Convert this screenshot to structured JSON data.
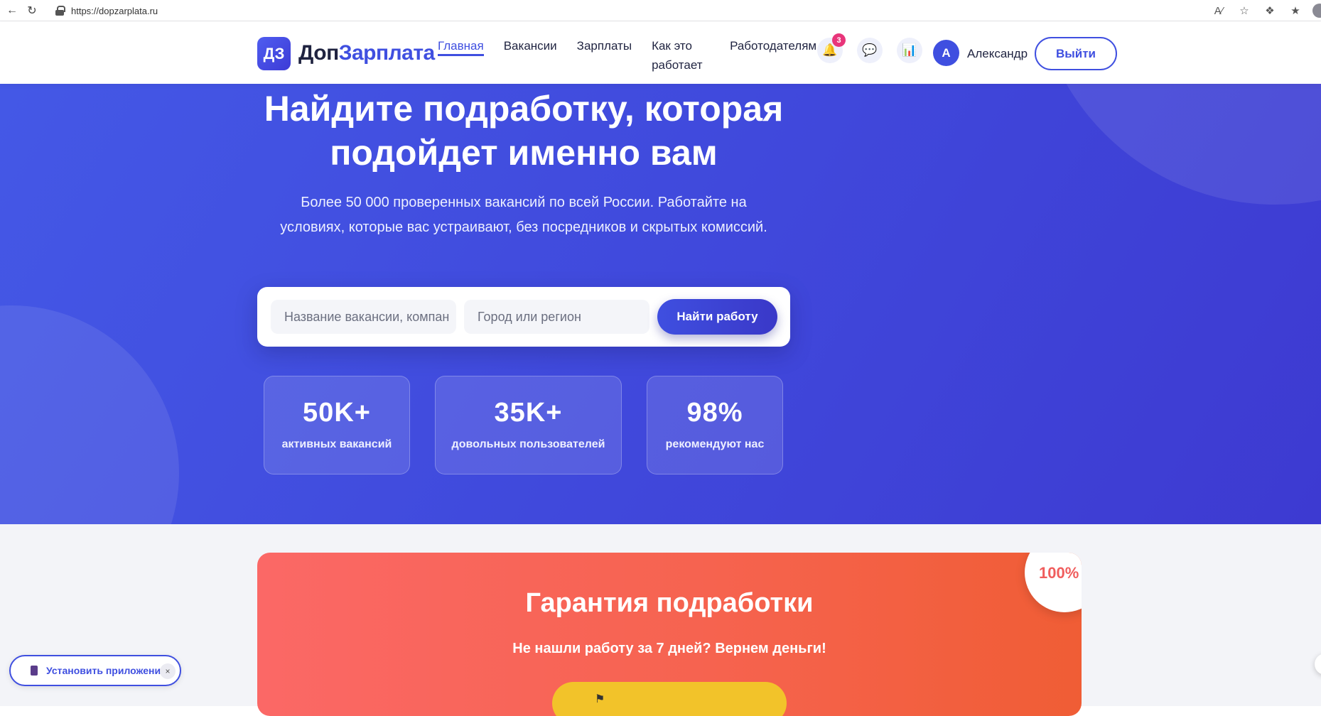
{
  "browser": {
    "url": "https://dopzarplata.ru"
  },
  "header": {
    "logo_badge": "ДЗ",
    "logo_text_1": "Доп",
    "logo_text_2": "Зарплата",
    "nav": [
      {
        "label": "Главная",
        "active": true
      },
      {
        "label": "Вакансии"
      },
      {
        "label": "Зарплаты"
      },
      {
        "label": "Как это работает"
      },
      {
        "label": "Работодателям"
      }
    ],
    "notification_count": "3",
    "icons": [
      "bell-icon",
      "chat-icon",
      "chart-icon"
    ],
    "avatar_letter": "А",
    "user_name": "Александр",
    "logout_label": "Выйти"
  },
  "hero": {
    "title": "Найдите подработку, которая подойдет именно вам",
    "subtitle": "Более 50 000 проверенных вакансий по всей России. Работайте на условиях, которые вас устраивают, без посредников и скрытых комиссий.",
    "search": {
      "job_placeholder": "Название вакансии, компан",
      "city_placeholder": "Город или регион",
      "button_label": "Найти работу"
    },
    "stats": [
      {
        "value": "50K+",
        "label": "активных вакансий"
      },
      {
        "value": "35K+",
        "label": "довольных пользователей"
      },
      {
        "value": "98%",
        "label": "рекомендуют нас"
      }
    ]
  },
  "guarantee": {
    "title": "Гарантия подработки",
    "subtitle": "Не нашли работу за 7 дней? Вернем деньги!",
    "badge": "100%"
  },
  "install": {
    "label": "Установить приложение",
    "close": "×"
  },
  "colors": {
    "primary": "#3f4fe0",
    "hero_start": "#4458e6",
    "hero_end": "#3d3ad1",
    "guarantee_start": "#fb6866",
    "guarantee_end": "#f05d35",
    "cta_yellow": "#f2c32a"
  }
}
